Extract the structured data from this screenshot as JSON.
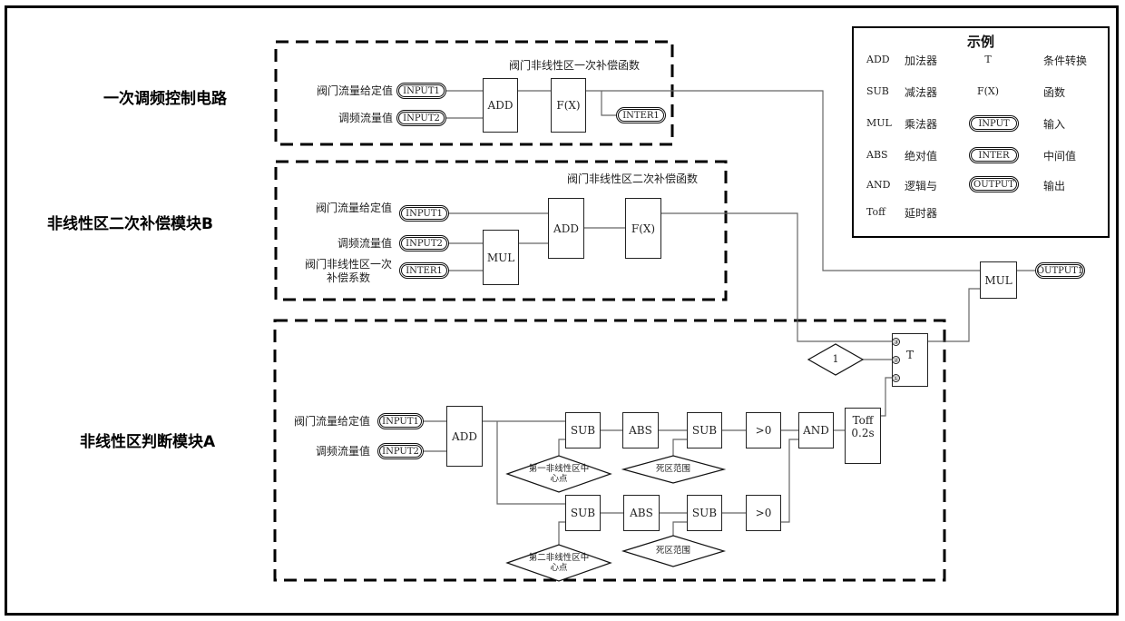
{
  "sections": {
    "primary": {
      "title": "一次调频控制电路",
      "subtitle": "阀门非线性区一次补偿函数"
    },
    "moduleB": {
      "title": "非线性区二次补偿模块B",
      "subtitle": "阀门非线性区二次补偿函数"
    },
    "moduleA": {
      "title": "非线性区判断模块A"
    }
  },
  "primary": {
    "inputs": [
      {
        "label": "阀门流量给定值",
        "tag": "INPUT1"
      },
      {
        "label": "调频流量值",
        "tag": "INPUT2"
      }
    ],
    "add": "ADD",
    "fx": "F(X)",
    "inter": "INTER1"
  },
  "moduleB": {
    "inputs": [
      {
        "label": "阀门流量给定值",
        "tag": "INPUT1"
      },
      {
        "label": "调频流量值",
        "tag": "INPUT2"
      },
      {
        "label_line1": "阀门非线性区一次",
        "label_line2": "补偿系数",
        "tag": "INTER1"
      }
    ],
    "mul": "MUL",
    "add": "ADD",
    "fx": "F(X)"
  },
  "moduleA": {
    "inputs": [
      {
        "label": "阀门流量给定值",
        "tag": "INPUT1"
      },
      {
        "label": "调频流量值",
        "tag": "INPUT2"
      }
    ],
    "add": "ADD",
    "row1": {
      "sub1": "SUB",
      "abs": "ABS",
      "sub2": "SUB",
      "gt": ">0",
      "center_line1": "第一非线性区中",
      "center_line2": "心点",
      "dead": "死区范围"
    },
    "row2": {
      "sub1": "SUB",
      "abs": "ABS",
      "sub2": "SUB",
      "gt": ">0",
      "center_line1": "第二非线性区中",
      "center_line2": "心点",
      "dead": "死区范围"
    },
    "and": "AND",
    "toff_line1": "Toff",
    "toff_line2": "0.2s"
  },
  "switch": {
    "label": "T",
    "const": "1",
    "ports": [
      "③",
      "②",
      "①"
    ]
  },
  "output": {
    "mul": "MUL",
    "tag": "OUTPUT1"
  },
  "legend": {
    "title": "示例",
    "rows": [
      {
        "code": "ADD",
        "name": "加法器",
        "symbol": "T",
        "symbol_type": "text",
        "meaning": "条件转换"
      },
      {
        "code": "SUB",
        "name": "减法器",
        "symbol": "F(X)",
        "symbol_type": "text",
        "meaning": "函数"
      },
      {
        "code": "MUL",
        "name": "乘法器",
        "symbol": "INPUT",
        "symbol_type": "pill",
        "meaning": "输入"
      },
      {
        "code": "ABS",
        "name": "绝对值",
        "symbol": "INTER",
        "symbol_type": "pill",
        "meaning": "中间值"
      },
      {
        "code": "AND",
        "name": "逻辑与",
        "symbol": "OUTPUT",
        "symbol_type": "pill",
        "meaning": "输出"
      },
      {
        "code": "Toff",
        "name": "延时器",
        "symbol": "",
        "symbol_type": "none",
        "meaning": ""
      }
    ]
  }
}
